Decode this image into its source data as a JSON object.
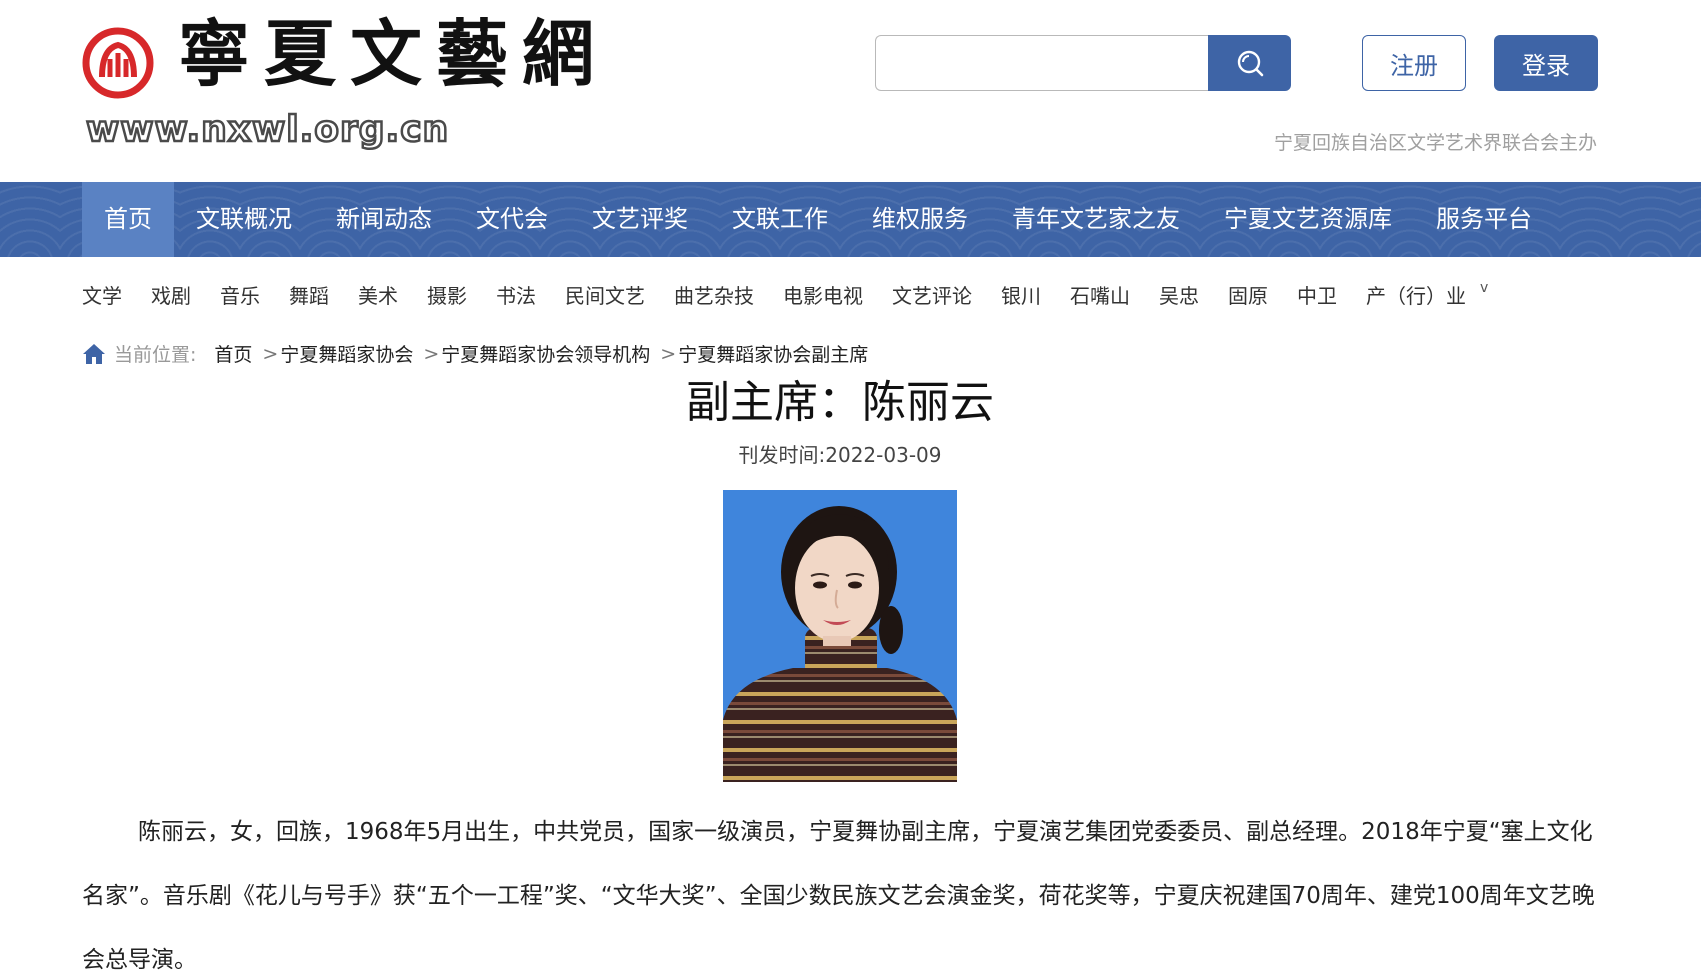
{
  "header": {
    "logo_title": "寧夏文藝網",
    "logo_url": "www.nxwl.org.cn",
    "search_placeholder": "",
    "register_label": "注册",
    "login_label": "登录",
    "host_text": "宁夏回族自治区文学艺术界联合会主办",
    "icons": {
      "search": "search-icon",
      "seal": "logo-seal-icon"
    },
    "colors": {
      "accent": "#3e64a6",
      "nav_active": "#5a82c3",
      "seal_red": "#d7282a"
    }
  },
  "main_nav": {
    "items": [
      {
        "label": "首页",
        "active": true
      },
      {
        "label": "文联概况"
      },
      {
        "label": "新闻动态"
      },
      {
        "label": "文代会"
      },
      {
        "label": "文艺评奖"
      },
      {
        "label": "文联工作"
      },
      {
        "label": "维权服务"
      },
      {
        "label": "青年文艺家之友"
      },
      {
        "label": "宁夏文艺资源库"
      },
      {
        "label": "服务平台"
      }
    ]
  },
  "sub_nav": {
    "items": [
      "文学",
      "戏剧",
      "音乐",
      "舞蹈",
      "美术",
      "摄影",
      "书法",
      "民间文艺",
      "曲艺杂技",
      "电影电视",
      "文艺评论",
      "银川",
      "石嘴山",
      "吴忠",
      "固原",
      "中卫",
      "产（行）业"
    ],
    "more_glyph": "v"
  },
  "breadcrumb": {
    "label": "当前位置:",
    "items": [
      "首页",
      "宁夏舞蹈家协会",
      "宁夏舞蹈家协会领导机构",
      "宁夏舞蹈家协会副主席"
    ],
    "separator": ">"
  },
  "article": {
    "title": "副主席：陈丽云",
    "pubdate": "刊发时间:2022-03-09",
    "body": "陈丽云，女，回族，1968年5月出生，中共党员，国家一级演员，宁夏舞协副主席，宁夏演艺集团党委委员、副总经理。2018年宁夏“塞上文化名家”。音乐剧《花儿与号手》获“五个一工程”奖、“文华大奖”、全国少数民族文艺会演金奖，荷花奖等，宁夏庆祝建国70周年、建党100周年文艺晚会总导演。"
  }
}
